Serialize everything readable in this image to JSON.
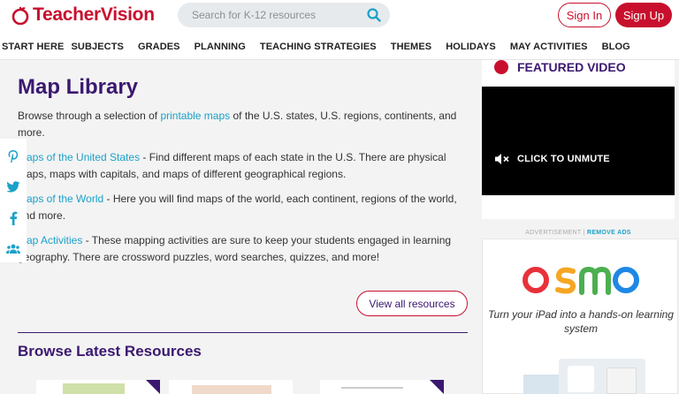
{
  "header": {
    "logo_text": "TeacherVision",
    "search_placeholder": "Search for K-12 resources",
    "signin_label": "Sign In",
    "signup_label": "Sign Up"
  },
  "nav": {
    "items": [
      "START HERE",
      "SUBJECTS",
      "GRADES",
      "PLANNING",
      "TEACHING STRATEGIES",
      "THEMES",
      "HOLIDAYS",
      "MAY ACTIVITIES",
      "BLOG"
    ]
  },
  "main": {
    "title": "Map Library",
    "intro_before": "Browse through a selection of ",
    "intro_link": "printable maps",
    "intro_after": " of the U.S. states, U.S. regions, continents, and more.",
    "us_link": "Maps of the United States",
    "us_text": " - Find different maps of each state in the U.S. There are physical maps, maps with capitals, and maps of different geographical regions.",
    "world_link": "Maps of the World",
    "world_text": " - Here you will find maps of the world, each continent, regions of the world, and more.",
    "activities_link": "Map Activities",
    "activities_text": " - These mapping activities are sure to keep your students engaged in learning geography. There are crossword puzzles, word searches, quizzes, and more!",
    "view_all_label": "View all resources",
    "latest_title": "Browse Latest Resources"
  },
  "sidebar": {
    "featured_title": "FEATURED VIDEO",
    "unmute_label": "CLICK TO UNMUTE",
    "ad_label": "ADVERTISEMENT",
    "remove_ads_label": "REMOVE ADS",
    "ad_brand": "osmo",
    "ad_copy": "Turn your iPad into a hands-on learning system"
  },
  "colors": {
    "brand_red": "#c8102e",
    "brand_purple": "#3b1870",
    "link_teal": "#1ba1c9"
  },
  "icons": [
    "logo-apple-icon",
    "search-icon",
    "pinterest-icon",
    "twitter-icon",
    "facebook-icon",
    "people-icon",
    "mute-icon"
  ]
}
